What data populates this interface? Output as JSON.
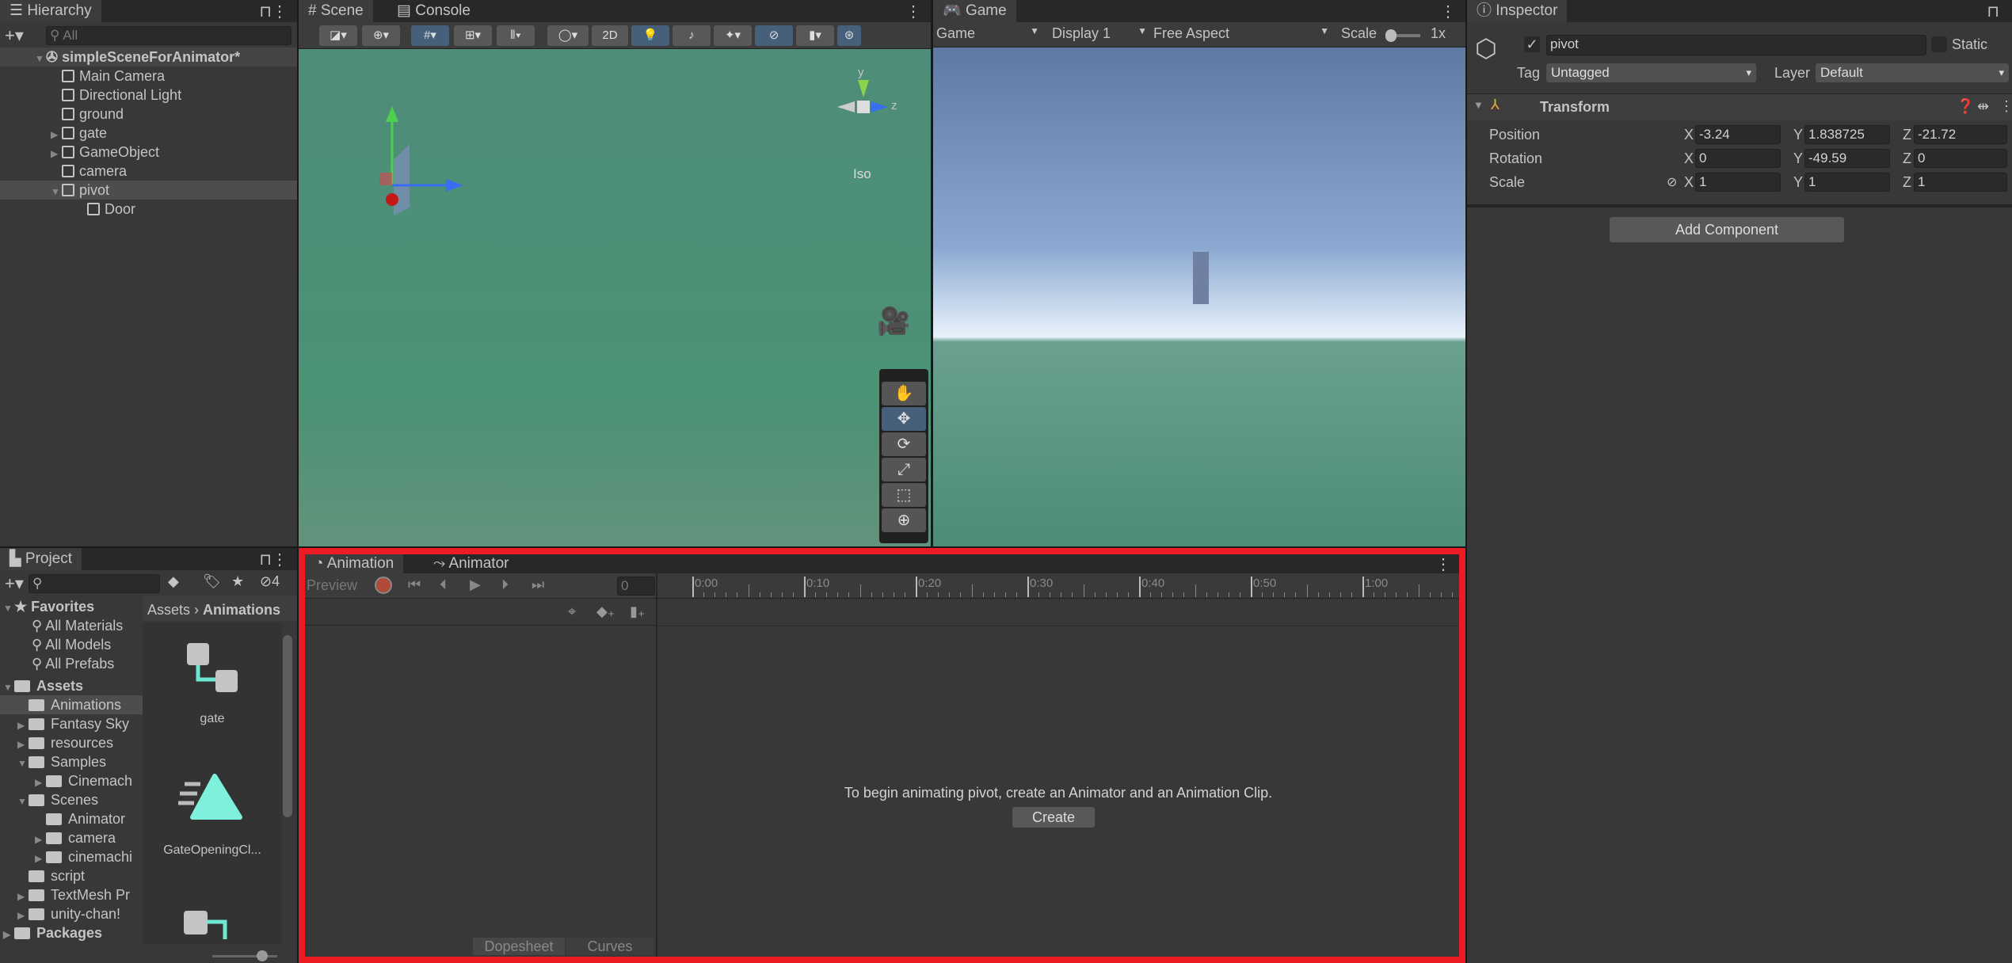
{
  "hierarchy": {
    "tab": "Hierarchy",
    "search_placeholder": "All",
    "scene": "simpleSceneForAnimator*",
    "items": [
      {
        "label": "Main Camera",
        "indent": 1,
        "arrow": false
      },
      {
        "label": "Directional Light",
        "indent": 1,
        "arrow": false
      },
      {
        "label": "ground",
        "indent": 1,
        "arrow": false
      },
      {
        "label": "gate",
        "indent": 1,
        "arrow": true
      },
      {
        "label": "GameObject",
        "indent": 1,
        "arrow": true
      },
      {
        "label": "camera",
        "indent": 1,
        "arrow": false
      },
      {
        "label": "pivot",
        "indent": 1,
        "arrow": "open",
        "selected": true
      },
      {
        "label": "Door",
        "indent": 2,
        "arrow": false
      }
    ]
  },
  "scene": {
    "tabs": [
      "Scene",
      "Console"
    ],
    "toolbar": {
      "two_d": "2D"
    },
    "gizmo": {
      "y": "y",
      "z": "z",
      "projection": "Iso"
    },
    "tools": [
      "hand-tool",
      "move-tool",
      "rotate-tool",
      "scale-tool",
      "rect-tool",
      "transform-tool"
    ],
    "active_tool": "move-tool"
  },
  "game": {
    "tab": "Game",
    "mode": "Game",
    "display": "Display 1",
    "aspect": "Free Aspect",
    "scale_label": "Scale",
    "scale_value": "1x"
  },
  "inspector": {
    "tab": "Inspector",
    "name": "pivot",
    "active": true,
    "static_label": "Static",
    "tag_label": "Tag",
    "tag": "Untagged",
    "layer_label": "Layer",
    "layer": "Default",
    "component": "Transform",
    "rows": [
      {
        "label": "Position",
        "x": "-3.24",
        "y": "1.838725",
        "z": "-21.72"
      },
      {
        "label": "Rotation",
        "x": "0",
        "y": "-49.59",
        "z": "0"
      },
      {
        "label": "Scale",
        "x": "1",
        "y": "1",
        "z": "1"
      }
    ],
    "axis": {
      "x": "X",
      "y": "Y",
      "z": "Z"
    },
    "add_component": "Add Component"
  },
  "project": {
    "tab": "Project",
    "hidden_count": "4",
    "favorites": "Favorites",
    "fav_items": [
      "All Materials",
      "All Models",
      "All Prefabs"
    ],
    "assets": "Assets",
    "packages": "Packages",
    "tree": [
      {
        "label": "Animations",
        "level": 1,
        "arrow": false,
        "selected": true
      },
      {
        "label": "Fantasy Sky",
        "level": 1,
        "arrow": true
      },
      {
        "label": "resources",
        "level": 1,
        "arrow": true
      },
      {
        "label": "Samples",
        "level": 1,
        "arrow": "open"
      },
      {
        "label": "Cinemach",
        "level": 2,
        "arrow": true
      },
      {
        "label": "Scenes",
        "level": 1,
        "arrow": "open"
      },
      {
        "label": "Animator",
        "level": 2,
        "arrow": false
      },
      {
        "label": "camera",
        "level": 2,
        "arrow": true
      },
      {
        "label": "cinemachi",
        "level": 2,
        "arrow": true
      },
      {
        "label": "script",
        "level": 1,
        "arrow": false
      },
      {
        "label": "TextMesh Pr",
        "level": 1,
        "arrow": true
      },
      {
        "label": "unity-chan!",
        "level": 1,
        "arrow": true
      }
    ],
    "breadcrumb": [
      "Assets",
      "Animations"
    ],
    "files": [
      {
        "label": "gate",
        "icon": "animator-controller-icon"
      },
      {
        "label": "GateOpeningCl...",
        "icon": "animation-clip-icon"
      }
    ]
  },
  "animation": {
    "tabs": [
      "Animation",
      "Animator"
    ],
    "preview": "Preview",
    "frame": "0",
    "ticks": [
      "0:00",
      "0:10",
      "0:20",
      "0:30",
      "0:40",
      "0:50",
      "1:00"
    ],
    "message": "To begin animating pivot, create an Animator and an Animation Clip.",
    "create": "Create",
    "bottom_tabs": [
      "Dopesheet",
      "Curves"
    ]
  },
  "colors": {
    "highlight": "#ed1c24",
    "accent": "#46607c",
    "scene_bg": "#4f8f78"
  }
}
